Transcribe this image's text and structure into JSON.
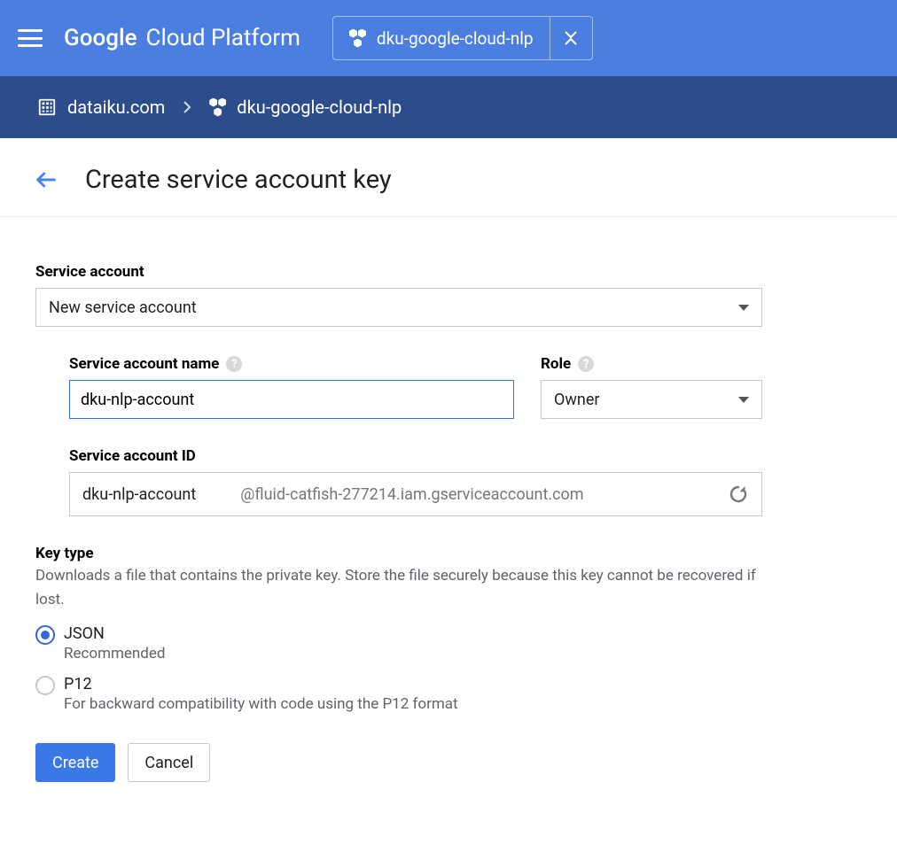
{
  "header": {
    "brand_google": "Google",
    "brand_rest": "Cloud Platform",
    "project_name": "dku-google-cloud-nlp"
  },
  "breadcrumb": {
    "org": "dataiku.com",
    "project": "dku-google-cloud-nlp"
  },
  "page": {
    "title": "Create service account key"
  },
  "form": {
    "service_account_label": "Service account",
    "service_account_value": "New service account",
    "name_label": "Service account name",
    "name_value": "dku-nlp-account",
    "role_label": "Role",
    "role_value": "Owner",
    "id_label": "Service account ID",
    "id_value": "dku-nlp-account",
    "id_suffix": "@fluid-catfish-277214.iam.gserviceaccount.com",
    "keytype_label": "Key type",
    "keytype_desc": "Downloads a file that contains the private key. Store the file securely because this key cannot be recovered if lost.",
    "options": {
      "json": {
        "label": "JSON",
        "sub": "Recommended"
      },
      "p12": {
        "label": "P12",
        "sub": "For backward compatibility with code using the P12 format"
      }
    },
    "create_label": "Create",
    "cancel_label": "Cancel"
  }
}
